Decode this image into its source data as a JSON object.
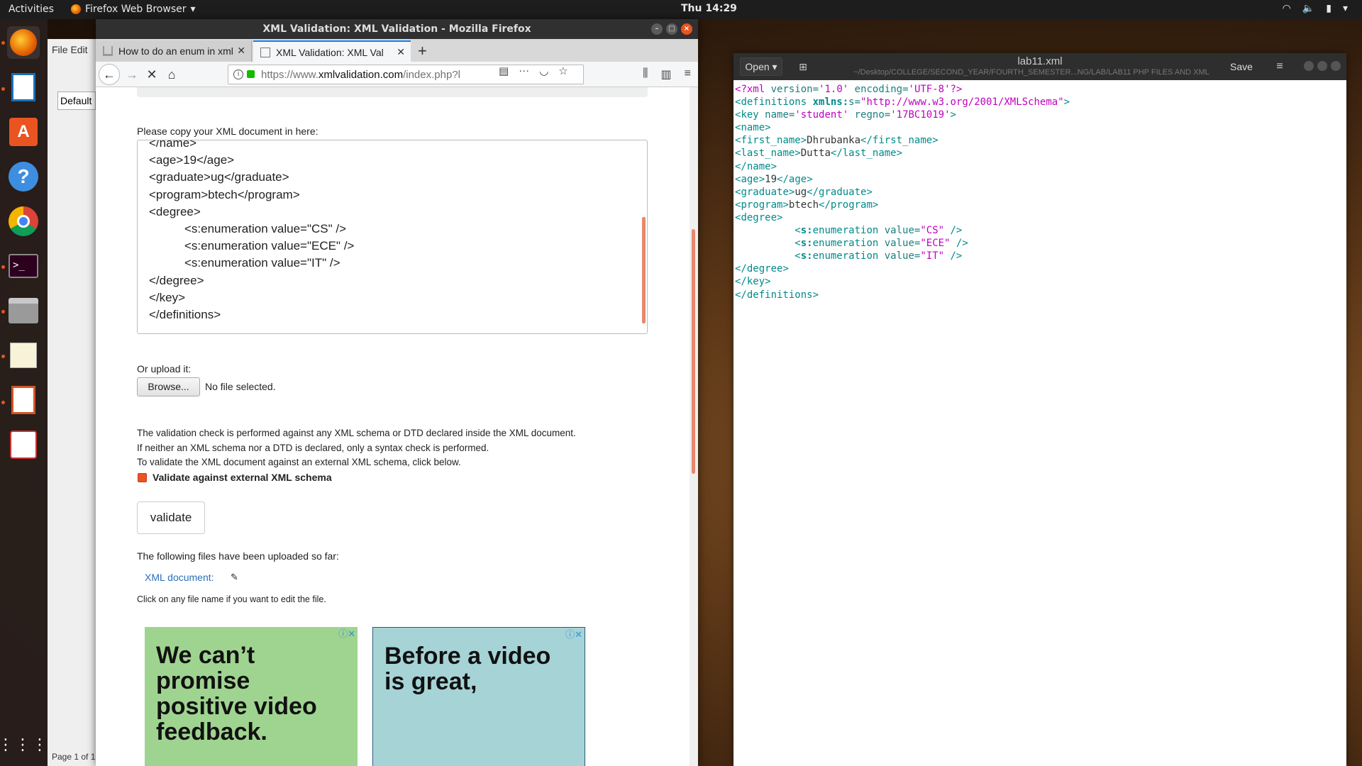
{
  "topbar": {
    "activities": "Activities",
    "app_menu": "Firefox Web Browser",
    "clock": "Thu 14:29"
  },
  "dock": {
    "items": [
      "firefox-icon",
      "writer-icon",
      "software-center-icon",
      "help-icon",
      "chrome-icon",
      "terminal-icon",
      "files-icon",
      "text-editor-icon",
      "impress-icon",
      "document-viewer-icon"
    ]
  },
  "libreoffice": {
    "menu": "File  Edit",
    "style": "Default",
    "status": "Page 1 of 1"
  },
  "firefox": {
    "title": "XML Validation: XML Validation - Mozilla Firefox",
    "tabs": [
      {
        "label": "How to do an enum in xml"
      },
      {
        "label": "XML Validation: XML Val"
      }
    ],
    "url_prefix": "https://www.",
    "url_host": "xmlvalidation.com",
    "url_rest": "/index.php?l"
  },
  "page": {
    "copy_label": "Please copy your XML document in here:",
    "textarea_lines": [
      {
        "text": "</name>",
        "indent": false
      },
      {
        "text": "<age>19</age>",
        "indent": false
      },
      {
        "text": "<graduate>ug</graduate>",
        "indent": false
      },
      {
        "text": "<program>btech</program>",
        "indent": false
      },
      {
        "text": "<degree>",
        "indent": false
      },
      {
        "text": "<s:enumeration value=\"CS\" />",
        "indent": true
      },
      {
        "text": "<s:enumeration value=\"ECE\" />",
        "indent": true
      },
      {
        "text": "<s:enumeration value=\"IT\" />",
        "indent": true
      },
      {
        "text": "</degree>",
        "indent": false
      },
      {
        "text": "</key>",
        "indent": false
      },
      {
        "text": "</definitions>",
        "indent": false
      }
    ],
    "upload_label": "Or upload it:",
    "browse_label": "Browse...",
    "no_file": "No file selected.",
    "info_lines": [
      "The validation check is performed against any XML schema or DTD declared inside the XML document.",
      "If neither an XML schema nor a DTD is declared, only a syntax check is performed.",
      "To validate the XML document against an external XML schema, click below."
    ],
    "checkbox_label": "Validate against external XML schema",
    "checkbox_checked": true,
    "validate_label": "validate",
    "uploaded_label": "The following files have been uploaded so far:",
    "xml_doc_link": "XML document:",
    "edit_note": "Click on any file name if you want to edit the file.",
    "ads": [
      "We can’t promise positive video feedback.",
      "Before a video is great,"
    ]
  },
  "gedit": {
    "open_label": "Open",
    "title": "lab11.xml",
    "path": "~/Desktop/COLLEGE/SECOND_YEAR/FOURTH_SEMESTER...NG/LAB/LAB11 PHP FILES AND XML",
    "save_label": "Save",
    "code_lines": [
      "<?xml version='1.0' encoding='UTF-8'?>",
      "<definitions xmlns:s=\"http://www.w3.org/2001/XMLSchema\">",
      "<key name='student' regno='17BC1019'>",
      "<name>",
      "<first_name>Dhrubanka</first_name>",
      "<last_name>Dutta</last_name>",
      "</name>",
      "<age>19</age>",
      "<graduate>ug</graduate>",
      "<program>btech</program>",
      "<degree>",
      "          <s:enumeration value=\"CS\" />",
      "          <s:enumeration value=\"ECE\" />",
      "          <s:enumeration value=\"IT\" />",
      "</degree>",
      "</key>",
      "</definitions>"
    ]
  }
}
